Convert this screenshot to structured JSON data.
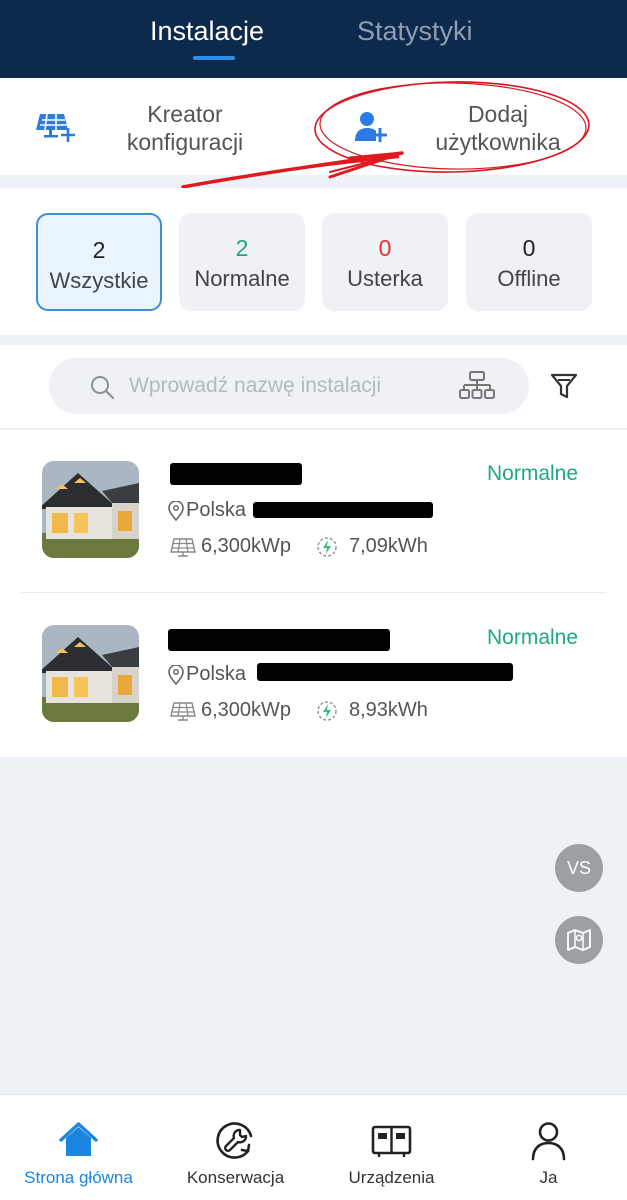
{
  "header": {
    "tabs": [
      {
        "label": "Instalacje",
        "active": true
      },
      {
        "label": "Statystyki",
        "active": false
      }
    ]
  },
  "actions": [
    {
      "label": "Kreator\nkonfiguracji",
      "icon": "solar-panel-plus-icon"
    },
    {
      "label": "Dodaj\nużytkownika",
      "icon": "add-user-icon"
    }
  ],
  "filters": [
    {
      "count": "2",
      "label": "Wszystkie",
      "active": true,
      "count_color": "#222222"
    },
    {
      "count": "2",
      "label": "Normalne",
      "active": false,
      "count_color": "#1fa883"
    },
    {
      "count": "0",
      "label": "Usterka",
      "active": false,
      "count_color": "#e2323a"
    },
    {
      "count": "0",
      "label": "Offline",
      "active": false,
      "count_color": "#222222"
    }
  ],
  "search": {
    "placeholder": "Wprowadź nazwę instalacji",
    "value": ""
  },
  "installations": [
    {
      "status": "Normalne",
      "location": "Polska",
      "power": "6,300kWp",
      "energy": "7,09kWh"
    },
    {
      "status": "Normalne",
      "location": "Polska",
      "power": "6,300kWp",
      "energy": "8,93kWh"
    }
  ],
  "floating": {
    "vs_label": "VS",
    "map_icon": "map-icon"
  },
  "nav": [
    {
      "label": "Strona główna",
      "icon": "home-icon",
      "active": true
    },
    {
      "label": "Konserwacja",
      "icon": "wrench-icon",
      "active": false
    },
    {
      "label": "Urządzenia",
      "icon": "devices-icon",
      "active": false
    },
    {
      "label": "Ja",
      "icon": "person-icon",
      "active": false
    }
  ],
  "colors": {
    "header_bg": "#0d2a4c",
    "accent": "#1a86e0",
    "status_normal": "#1fa883",
    "status_fault": "#e2323a",
    "annotation": "#e0191f"
  }
}
